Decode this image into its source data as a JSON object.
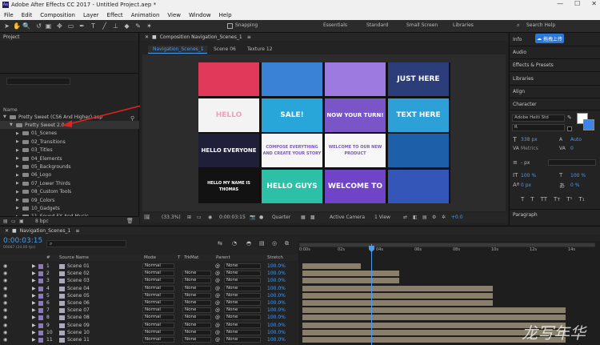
{
  "window": {
    "title": "Adobe After Effects CC 2017 - Untitled Project.aep *",
    "controls": [
      "—",
      "☐",
      "✕"
    ]
  },
  "menu": [
    "File",
    "Edit",
    "Composition",
    "Layer",
    "Effect",
    "Animation",
    "View",
    "Window",
    "Help"
  ],
  "toolbar": {
    "snapping": "Snapping",
    "workspaces": [
      "Essentials",
      "Standard",
      "Small Screen",
      "Libraries"
    ],
    "search_placeholder": "Search Help"
  },
  "project": {
    "title": "Project",
    "col_name": "Name",
    "items": [
      {
        "label": "Pretty Sweet (CS6 And Higher).aep",
        "depth": 0,
        "open": true
      },
      {
        "label": "Pretty Sweet 2.0",
        "depth": 1,
        "open": true,
        "selected": true
      },
      {
        "label": "01_Scenes",
        "depth": 2
      },
      {
        "label": "02_Transitions",
        "depth": 2
      },
      {
        "label": "03_Titles",
        "depth": 2
      },
      {
        "label": "04_Elements",
        "depth": 2
      },
      {
        "label": "05_Backgrounds",
        "depth": 2
      },
      {
        "label": "06_Logo",
        "depth": 2
      },
      {
        "label": "07_Lower Thirds",
        "depth": 2
      },
      {
        "label": "08_Custom Tools",
        "depth": 2
      },
      {
        "label": "09_Colors",
        "depth": 2
      },
      {
        "label": "10_Gadgets",
        "depth": 2
      },
      {
        "label": "11_Sound FX And Music",
        "depth": 2
      }
    ],
    "bpc": "8 bpc"
  },
  "composition": {
    "panel_title": "Composition Navigation_Scenes_1",
    "tabs": [
      "Navigation_Scenes_1",
      "Scene 06",
      "Texture 12"
    ],
    "footer": {
      "zoom": "(33.3%)",
      "timecode": "0:00:03:15",
      "resolution": "Quarter",
      "camera": "Active Camera",
      "view": "1 View",
      "exposure": "+0.0"
    },
    "tiles": [
      {
        "text": "",
        "bg": "#e0395a"
      },
      {
        "text": "",
        "bg": "#3a82d6"
      },
      {
        "text": "",
        "bg": "#9d7ae0"
      },
      {
        "text": "JUST HERE",
        "bg": "#2b3e7a"
      },
      {
        "text": "HELLO",
        "bg": "#f3f3f3"
      },
      {
        "text": "SALE!",
        "bg": "#29a6d9"
      },
      {
        "text": "NOW YOUR TURN!",
        "bg": "#7a55c8"
      },
      {
        "text": "TEXT HERE",
        "bg": "#2da0d8"
      },
      {
        "text": "HELLO EVERYONE",
        "bg": "#1f1f3a"
      },
      {
        "text": "COMPOSE EVERYTHING AND CREATE YOUR STORY",
        "bg": "#f6f6f6"
      },
      {
        "text": "WELCOME TO OUR NEW PRODUCT",
        "bg": "#f7f7f7"
      },
      {
        "text": "",
        "bg": "#1d5fa8"
      },
      {
        "text": "HELLO MY NAME IS THOMAS",
        "bg": "#121212"
      },
      {
        "text": "HELLO GUYS",
        "bg": "#2cc0a6"
      },
      {
        "text": "WELCOME TO",
        "bg": "#6f44c6"
      },
      {
        "text": "",
        "bg": "#3356b8"
      }
    ]
  },
  "right": {
    "items": [
      "Info",
      "Audio",
      "Effects & Presets",
      "Libraries",
      "Align",
      "Character",
      "Paragraph"
    ],
    "upload_button": "拖拽上传",
    "font": "Adobe Heiti Std",
    "style": "R",
    "size": "338 px",
    "leading": "Auto",
    "tracking_label": "Metrics",
    "tracking": "0",
    "stroke": "- px",
    "vscale": "100 %",
    "hscale": "100 %",
    "baseline": "0 px",
    "tsume": "0 %",
    "buttons": [
      "T",
      "T",
      "TT",
      "Tт",
      "T¹",
      "T₁"
    ]
  },
  "timeline": {
    "tab": "Navigation_Scenes_1",
    "timecode": "0:00:03:15",
    "fps": "00087 (24.00 fps)",
    "columns": [
      "#",
      "Source Name",
      "Mode",
      "T",
      "TrkMat",
      "Parent",
      "Stretch"
    ],
    "ruler": [
      "0:00s",
      "02s",
      "04s",
      "06s",
      "08s",
      "10s",
      "12s",
      "14s"
    ],
    "layers": [
      {
        "num": "1",
        "name": "Scene 01",
        "mode": "Normal",
        "trkmat": "",
        "parent": "None",
        "stretch": "100.0%",
        "bar_end": 0.2
      },
      {
        "num": "2",
        "name": "Scene 02",
        "mode": "Normal",
        "trkmat": "None",
        "parent": "None",
        "stretch": "100.0%",
        "bar_end": 0.33
      },
      {
        "num": "3",
        "name": "Scene 03",
        "mode": "Normal",
        "trkmat": "None",
        "parent": "None",
        "stretch": "100.0%",
        "bar_end": 0.33
      },
      {
        "num": "4",
        "name": "Scene 04",
        "mode": "Normal",
        "trkmat": "None",
        "parent": "None",
        "stretch": "100.0%",
        "bar_end": 0.65
      },
      {
        "num": "5",
        "name": "Scene 05",
        "mode": "Normal",
        "trkmat": "None",
        "parent": "None",
        "stretch": "100.0%",
        "bar_end": 0.65
      },
      {
        "num": "6",
        "name": "Scene 06",
        "mode": "Normal",
        "trkmat": "None",
        "parent": "None",
        "stretch": "100.0%",
        "bar_end": 0.65
      },
      {
        "num": "7",
        "name": "Scene 07",
        "mode": "Normal",
        "trkmat": "None",
        "parent": "None",
        "stretch": "100.0%",
        "bar_end": 0.9
      },
      {
        "num": "8",
        "name": "Scene 08",
        "mode": "Normal",
        "trkmat": "None",
        "parent": "None",
        "stretch": "100.0%",
        "bar_end": 0.9
      },
      {
        "num": "9",
        "name": "Scene 09",
        "mode": "Normal",
        "trkmat": "None",
        "parent": "None",
        "stretch": "100.0%",
        "bar_end": 0.9
      },
      {
        "num": "10",
        "name": "Scene 10",
        "mode": "Normal",
        "trkmat": "None",
        "parent": "None",
        "stretch": "100.0%",
        "bar_end": 0.9
      },
      {
        "num": "11",
        "name": "Scene 11",
        "mode": "Normal",
        "trkmat": "None",
        "parent": "None",
        "stretch": "100.0%",
        "bar_end": 0.9
      }
    ]
  },
  "watermark": "龙写年华"
}
